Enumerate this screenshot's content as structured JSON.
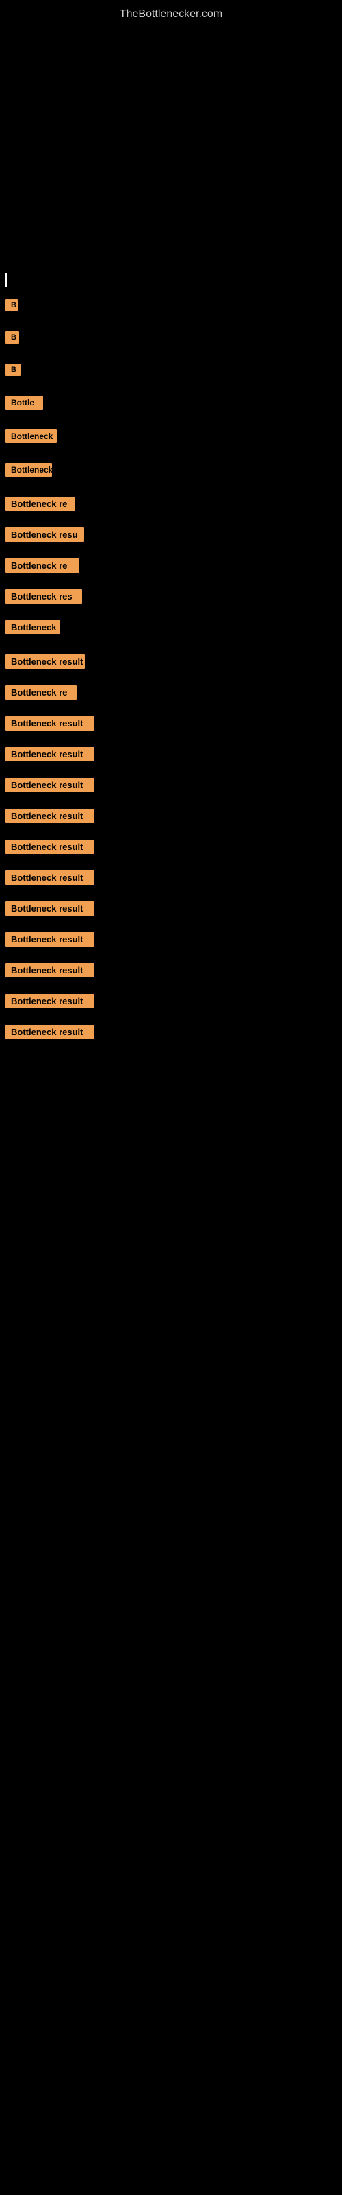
{
  "site": {
    "title": "TheBottlenecker.com"
  },
  "rows": [
    {
      "id": 1,
      "label": "Bottleneck result",
      "width_class": "w-tiny1"
    },
    {
      "id": 2,
      "label": "Bottleneck result",
      "width_class": "w-tiny2"
    },
    {
      "id": 3,
      "label": "Bottleneck result",
      "width_class": "w-tiny3"
    },
    {
      "id": 4,
      "label": "Bottleneck result",
      "width_class": "w-short1"
    },
    {
      "id": 5,
      "label": "Bottleneck result",
      "width_class": "w-short2"
    },
    {
      "id": 6,
      "label": "Bottleneck result",
      "width_class": "w-short3"
    },
    {
      "id": 7,
      "label": "Bottleneck result",
      "width_class": "w-med1"
    },
    {
      "id": 8,
      "label": "Bottleneck result",
      "width_class": "w-med2"
    },
    {
      "id": 9,
      "label": "Bottleneck result",
      "width_class": "w-med3"
    },
    {
      "id": 10,
      "label": "Bottleneck result",
      "width_class": "w-med4"
    },
    {
      "id": 11,
      "label": "Bottleneck result",
      "width_class": "w-med5"
    },
    {
      "id": 12,
      "label": "Bottleneck result",
      "width_class": "w-med6"
    },
    {
      "id": 13,
      "label": "Bottleneck result",
      "width_class": "w-med7"
    },
    {
      "id": 14,
      "label": "Bottleneck result",
      "width_class": "w-full1"
    },
    {
      "id": 15,
      "label": "Bottleneck result",
      "width_class": "w-full2"
    },
    {
      "id": 16,
      "label": "Bottleneck result",
      "width_class": "w-full3"
    },
    {
      "id": 17,
      "label": "Bottleneck result",
      "width_class": "w-full4"
    },
    {
      "id": 18,
      "label": "Bottleneck result",
      "width_class": "w-full5"
    },
    {
      "id": 19,
      "label": "Bottleneck result",
      "width_class": "w-full6"
    },
    {
      "id": 20,
      "label": "Bottleneck result",
      "width_class": "w-full7"
    },
    {
      "id": 21,
      "label": "Bottleneck result",
      "width_class": "w-full8"
    },
    {
      "id": 22,
      "label": "Bottleneck result",
      "width_class": "w-full9"
    },
    {
      "id": 23,
      "label": "Bottleneck result",
      "width_class": "w-full10"
    },
    {
      "id": 24,
      "label": "Bottleneck result",
      "width_class": "w-full11"
    }
  ]
}
